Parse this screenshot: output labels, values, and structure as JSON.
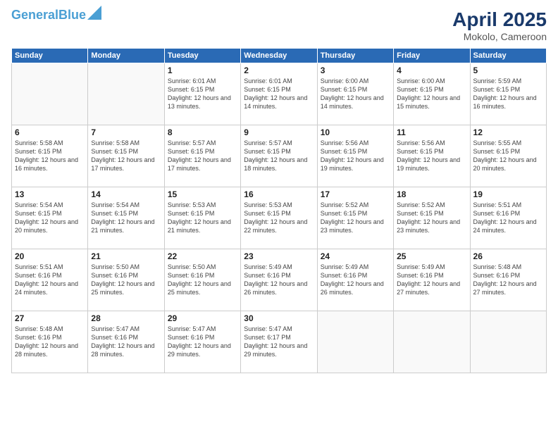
{
  "header": {
    "logo_line1": "General",
    "logo_line2": "Blue",
    "title": "April 2025",
    "subtitle": "Mokolo, Cameroon"
  },
  "weekdays": [
    "Sunday",
    "Monday",
    "Tuesday",
    "Wednesday",
    "Thursday",
    "Friday",
    "Saturday"
  ],
  "days": [
    {
      "num": "",
      "info": ""
    },
    {
      "num": "",
      "info": ""
    },
    {
      "num": "1",
      "info": "Sunrise: 6:01 AM\nSunset: 6:15 PM\nDaylight: 12 hours and 13 minutes."
    },
    {
      "num": "2",
      "info": "Sunrise: 6:01 AM\nSunset: 6:15 PM\nDaylight: 12 hours and 14 minutes."
    },
    {
      "num": "3",
      "info": "Sunrise: 6:00 AM\nSunset: 6:15 PM\nDaylight: 12 hours and 14 minutes."
    },
    {
      "num": "4",
      "info": "Sunrise: 6:00 AM\nSunset: 6:15 PM\nDaylight: 12 hours and 15 minutes."
    },
    {
      "num": "5",
      "info": "Sunrise: 5:59 AM\nSunset: 6:15 PM\nDaylight: 12 hours and 16 minutes."
    },
    {
      "num": "6",
      "info": "Sunrise: 5:58 AM\nSunset: 6:15 PM\nDaylight: 12 hours and 16 minutes."
    },
    {
      "num": "7",
      "info": "Sunrise: 5:58 AM\nSunset: 6:15 PM\nDaylight: 12 hours and 17 minutes."
    },
    {
      "num": "8",
      "info": "Sunrise: 5:57 AM\nSunset: 6:15 PM\nDaylight: 12 hours and 17 minutes."
    },
    {
      "num": "9",
      "info": "Sunrise: 5:57 AM\nSunset: 6:15 PM\nDaylight: 12 hours and 18 minutes."
    },
    {
      "num": "10",
      "info": "Sunrise: 5:56 AM\nSunset: 6:15 PM\nDaylight: 12 hours and 19 minutes."
    },
    {
      "num": "11",
      "info": "Sunrise: 5:56 AM\nSunset: 6:15 PM\nDaylight: 12 hours and 19 minutes."
    },
    {
      "num": "12",
      "info": "Sunrise: 5:55 AM\nSunset: 6:15 PM\nDaylight: 12 hours and 20 minutes."
    },
    {
      "num": "13",
      "info": "Sunrise: 5:54 AM\nSunset: 6:15 PM\nDaylight: 12 hours and 20 minutes."
    },
    {
      "num": "14",
      "info": "Sunrise: 5:54 AM\nSunset: 6:15 PM\nDaylight: 12 hours and 21 minutes."
    },
    {
      "num": "15",
      "info": "Sunrise: 5:53 AM\nSunset: 6:15 PM\nDaylight: 12 hours and 21 minutes."
    },
    {
      "num": "16",
      "info": "Sunrise: 5:53 AM\nSunset: 6:15 PM\nDaylight: 12 hours and 22 minutes."
    },
    {
      "num": "17",
      "info": "Sunrise: 5:52 AM\nSunset: 6:15 PM\nDaylight: 12 hours and 23 minutes."
    },
    {
      "num": "18",
      "info": "Sunrise: 5:52 AM\nSunset: 6:15 PM\nDaylight: 12 hours and 23 minutes."
    },
    {
      "num": "19",
      "info": "Sunrise: 5:51 AM\nSunset: 6:16 PM\nDaylight: 12 hours and 24 minutes."
    },
    {
      "num": "20",
      "info": "Sunrise: 5:51 AM\nSunset: 6:16 PM\nDaylight: 12 hours and 24 minutes."
    },
    {
      "num": "21",
      "info": "Sunrise: 5:50 AM\nSunset: 6:16 PM\nDaylight: 12 hours and 25 minutes."
    },
    {
      "num": "22",
      "info": "Sunrise: 5:50 AM\nSunset: 6:16 PM\nDaylight: 12 hours and 25 minutes."
    },
    {
      "num": "23",
      "info": "Sunrise: 5:49 AM\nSunset: 6:16 PM\nDaylight: 12 hours and 26 minutes."
    },
    {
      "num": "24",
      "info": "Sunrise: 5:49 AM\nSunset: 6:16 PM\nDaylight: 12 hours and 26 minutes."
    },
    {
      "num": "25",
      "info": "Sunrise: 5:49 AM\nSunset: 6:16 PM\nDaylight: 12 hours and 27 minutes."
    },
    {
      "num": "26",
      "info": "Sunrise: 5:48 AM\nSunset: 6:16 PM\nDaylight: 12 hours and 27 minutes."
    },
    {
      "num": "27",
      "info": "Sunrise: 5:48 AM\nSunset: 6:16 PM\nDaylight: 12 hours and 28 minutes."
    },
    {
      "num": "28",
      "info": "Sunrise: 5:47 AM\nSunset: 6:16 PM\nDaylight: 12 hours and 28 minutes."
    },
    {
      "num": "29",
      "info": "Sunrise: 5:47 AM\nSunset: 6:16 PM\nDaylight: 12 hours and 29 minutes."
    },
    {
      "num": "30",
      "info": "Sunrise: 5:47 AM\nSunset: 6:17 PM\nDaylight: 12 hours and 29 minutes."
    },
    {
      "num": "",
      "info": ""
    },
    {
      "num": "",
      "info": ""
    },
    {
      "num": "",
      "info": ""
    }
  ]
}
